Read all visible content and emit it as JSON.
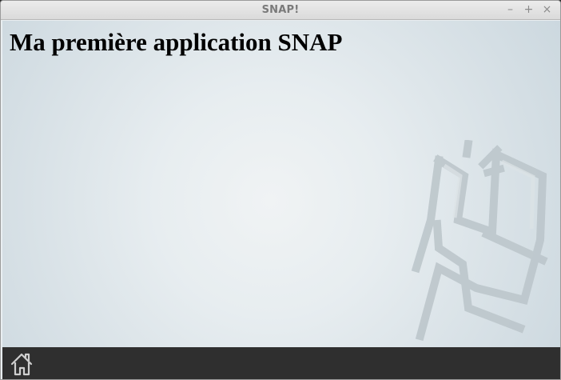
{
  "window": {
    "title": "SNAP!",
    "controls": {
      "minimize": "–",
      "maximize": "+",
      "close": "×"
    }
  },
  "main": {
    "heading": "Ma première application SNAP"
  },
  "bottom_bar": {
    "home_icon": "home-icon"
  },
  "colors": {
    "title_text": "#7a7a7a",
    "content_background_center": "#f0f3f4",
    "content_background_edge": "#ccd8df",
    "watermark": "#bcc6cb",
    "bottom_bar": "#2f2f2f",
    "home_icon": "#cfcfcf"
  }
}
